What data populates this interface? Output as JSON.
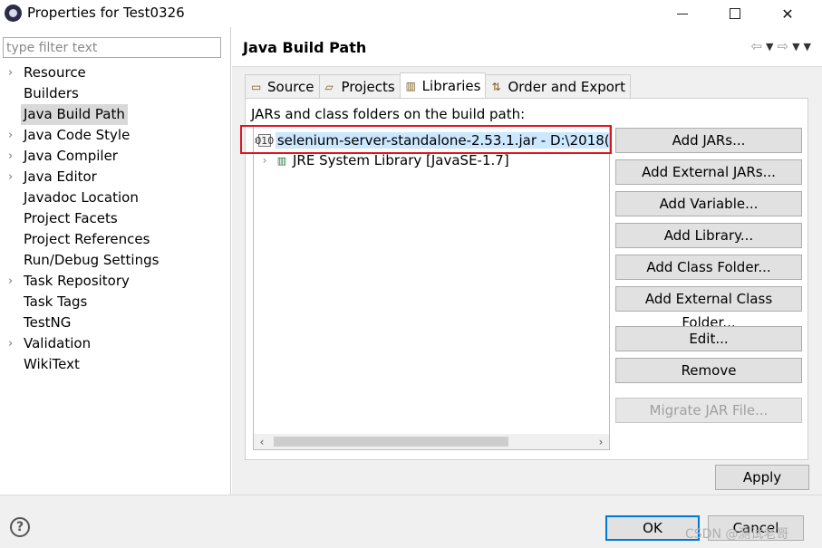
{
  "window": {
    "title": "Properties for Test0326"
  },
  "filter": {
    "placeholder": "type filter text",
    "value": ""
  },
  "nav": {
    "items": [
      {
        "label": "Resource",
        "expandable": true
      },
      {
        "label": "Builders",
        "expandable": false
      },
      {
        "label": "Java Build Path",
        "expandable": false,
        "selected": true
      },
      {
        "label": "Java Code Style",
        "expandable": true
      },
      {
        "label": "Java Compiler",
        "expandable": true
      },
      {
        "label": "Java Editor",
        "expandable": true
      },
      {
        "label": "Javadoc Location",
        "expandable": false
      },
      {
        "label": "Project Facets",
        "expandable": false
      },
      {
        "label": "Project References",
        "expandable": false
      },
      {
        "label": "Run/Debug Settings",
        "expandable": false
      },
      {
        "label": "Task Repository",
        "expandable": true
      },
      {
        "label": "Task Tags",
        "expandable": false
      },
      {
        "label": "TestNG",
        "expandable": false
      },
      {
        "label": "Validation",
        "expandable": true
      },
      {
        "label": "WikiText",
        "expandable": false
      }
    ]
  },
  "page": {
    "title": "Java Build Path"
  },
  "tabs": [
    {
      "label": "Source",
      "icon": "source-folder-icon"
    },
    {
      "label": "Projects",
      "icon": "projects-icon"
    },
    {
      "label": "Libraries",
      "icon": "libraries-icon",
      "active": true
    },
    {
      "label": "Order and Export",
      "icon": "order-export-icon"
    }
  ],
  "libraries": {
    "label": "JARs and class folders on the build path:",
    "entries": [
      {
        "text": "selenium-server-standalone-2.53.1.jar - D:\\2018(",
        "icon": "jar-icon",
        "selected": true
      },
      {
        "text": "JRE System Library [JavaSE-1.7]",
        "icon": "library-icon"
      }
    ]
  },
  "buttons": {
    "add_jars": "Add JARs...",
    "add_external_jars": "Add External JARs...",
    "add_variable": "Add Variable...",
    "add_library": "Add Library...",
    "add_class_folder": "Add Class Folder...",
    "add_external_class_folder": "Add External Class Folder...",
    "edit": "Edit...",
    "remove": "Remove",
    "migrate": "Migrate JAR File..."
  },
  "apply": "Apply",
  "footer": {
    "ok": "OK",
    "cancel": "Cancel",
    "help": "?"
  },
  "watermark": "CSDN @测试老哥",
  "colors": {
    "selection": "#cce8ff",
    "highlight_border": "#e0141b",
    "default_button_border": "#0078d7"
  }
}
